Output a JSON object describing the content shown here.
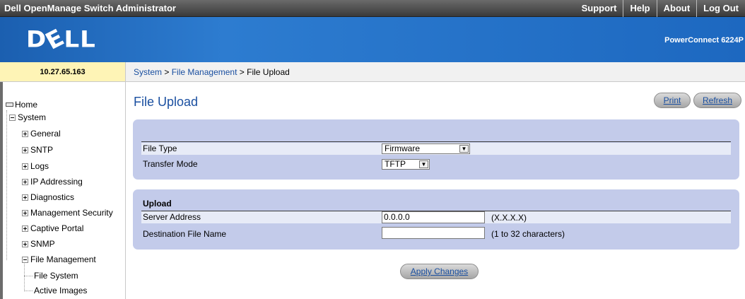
{
  "header": {
    "app_title": "Dell OpenManage Switch Administrator",
    "nav": [
      "Support",
      "Help",
      "About",
      "Log Out"
    ],
    "logo_text": "DELL",
    "model": "PowerConnect 6224P"
  },
  "ip_address": "10.27.65.163",
  "breadcrumb": {
    "system": "System",
    "sep1": " > ",
    "file_management": "File Management",
    "sep2": " > ",
    "current": "File Upload"
  },
  "sidebar": {
    "home": "Home",
    "system": "System",
    "items": [
      "General",
      "SNTP",
      "Logs",
      "IP Addressing",
      "Diagnostics",
      "Management Security",
      "Captive Portal",
      "SNMP",
      "File Management"
    ],
    "sub_items": [
      "File System",
      "Active Images"
    ]
  },
  "page": {
    "title": "File Upload",
    "print_label": "Print",
    "refresh_label": "Refresh"
  },
  "form": {
    "file_type_label": "File Type",
    "file_type_value": "Firmware",
    "transfer_mode_label": "Transfer Mode",
    "transfer_mode_value": "TFTP",
    "upload_title": "Upload",
    "server_address_label": "Server Address",
    "server_address_value": "0.0.0.0",
    "server_address_hint": "(X.X.X.X)",
    "dest_file_label": "Destination File Name",
    "dest_file_value": "",
    "dest_file_hint": "(1 to 32 characters)",
    "apply_label": "Apply Changes"
  },
  "colors": {
    "banner": "#2d7cd0",
    "panel": "#c3cbea",
    "link": "#1a4fa0",
    "ip_box": "#fef4b6"
  }
}
